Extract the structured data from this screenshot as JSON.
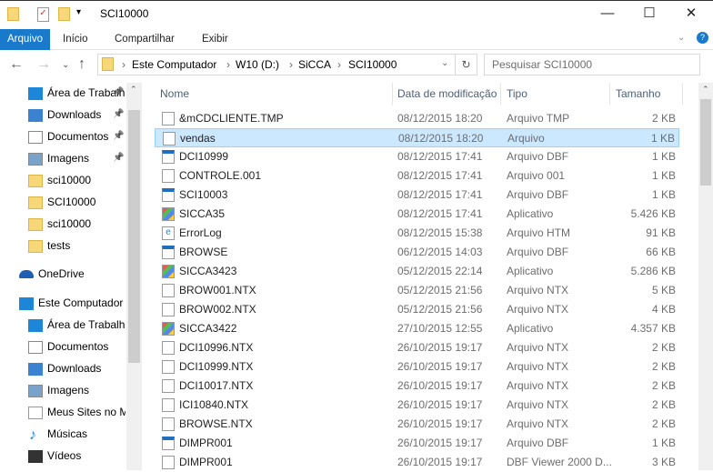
{
  "window": {
    "title": "SCI10000",
    "minimize": "—",
    "maximize": "☐",
    "close": "✕"
  },
  "ribbon": {
    "tabs": [
      "Arquivo",
      "Início",
      "Compartilhar",
      "Exibir"
    ]
  },
  "address": {
    "segments": [
      "Este Computador",
      "W10 (D:)",
      "SiCCA",
      "SCI10000"
    ],
    "separator": "›"
  },
  "search": {
    "placeholder": "Pesquisar SCI10000"
  },
  "sidebar": {
    "quick": [
      {
        "label": "Área de Trabalho",
        "icon": "desktop"
      },
      {
        "label": "Downloads",
        "icon": "download"
      },
      {
        "label": "Documentos",
        "icon": "documents"
      },
      {
        "label": "Imagens",
        "icon": "images"
      },
      {
        "label": "sci10000",
        "icon": "folder"
      },
      {
        "label": "SCI10000",
        "icon": "folder"
      },
      {
        "label": "sci10000",
        "icon": "folder"
      },
      {
        "label": "tests",
        "icon": "folder"
      }
    ],
    "onedrive": "OneDrive",
    "computer": "Este Computador",
    "computer_items": [
      {
        "label": "Área de Trabalho",
        "icon": "desktop"
      },
      {
        "label": "Documentos",
        "icon": "documents"
      },
      {
        "label": "Downloads",
        "icon": "download"
      },
      {
        "label": "Imagens",
        "icon": "images"
      },
      {
        "label": "Meus Sites no MSN",
        "icon": "file"
      },
      {
        "label": "Músicas",
        "icon": "music"
      },
      {
        "label": "Vídeos",
        "icon": "video"
      }
    ]
  },
  "columns": [
    "Nome",
    "Data de modificação",
    "Tipo",
    "Tamanho"
  ],
  "files": [
    [
      "&mCDCLIENTE.TMP",
      "08/12/2015 18:20",
      "Arquivo TMP",
      "2 KB"
    ],
    [
      "vendas",
      "08/12/2015 18:20",
      "Arquivo",
      "1 KB"
    ],
    [
      "DCI10999",
      "08/12/2015 17:41",
      "Arquivo DBF",
      "1 KB"
    ],
    [
      "CONTROLE.001",
      "08/12/2015 17:41",
      "Arquivo 001",
      "1 KB"
    ],
    [
      "SCI10003",
      "08/12/2015 17:41",
      "Arquivo DBF",
      "1 KB"
    ],
    [
      "SICCA35",
      "08/12/2015 17:41",
      "Aplicativo",
      "5.426 KB"
    ],
    [
      "ErrorLog",
      "08/12/2015 15:38",
      "Arquivo HTM",
      "91 KB"
    ],
    [
      "BROWSE",
      "06/12/2015 14:03",
      "Arquivo DBF",
      "66 KB"
    ],
    [
      "SICCA3423",
      "05/12/2015 22:14",
      "Aplicativo",
      "5.286 KB"
    ],
    [
      "BROW001.NTX",
      "05/12/2015 21:56",
      "Arquivo NTX",
      "5 KB"
    ],
    [
      "BROW002.NTX",
      "05/12/2015 21:56",
      "Arquivo NTX",
      "4 KB"
    ],
    [
      "SICCA3422",
      "27/10/2015 12:55",
      "Aplicativo",
      "4.357 KB"
    ],
    [
      "DCI10996.NTX",
      "26/10/2015 19:17",
      "Arquivo NTX",
      "2 KB"
    ],
    [
      "DCI10999.NTX",
      "26/10/2015 19:17",
      "Arquivo NTX",
      "2 KB"
    ],
    [
      "DCI10017.NTX",
      "26/10/2015 19:17",
      "Arquivo NTX",
      "2 KB"
    ],
    [
      "ICI10840.NTX",
      "26/10/2015 19:17",
      "Arquivo NTX",
      "2 KB"
    ],
    [
      "BROWSE.NTX",
      "26/10/2015 19:17",
      "Arquivo NTX",
      "2 KB"
    ],
    [
      "DIMPR001",
      "26/10/2015 19:17",
      "Arquivo DBF",
      "1 KB"
    ],
    [
      "DIMPR001",
      "26/10/2015 19:17",
      "DBF Viewer 2000 D...",
      "3 KB"
    ]
  ],
  "selected_index": 1
}
